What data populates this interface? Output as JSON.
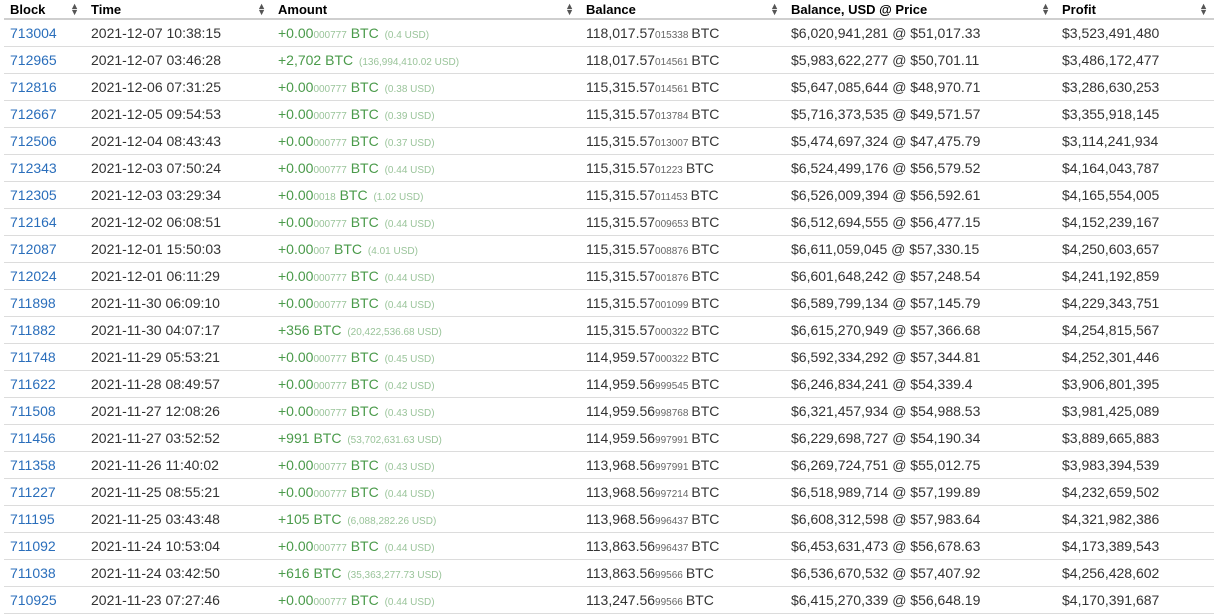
{
  "headers": [
    "Block",
    "Time",
    "Amount",
    "Balance",
    "Balance, USD @ Price",
    "Profit"
  ],
  "rows": [
    {
      "block": "713004",
      "time": "2021-12-07 10:38:15",
      "amount": "+0.00",
      "amount_small": "000777",
      "unit": "BTC",
      "amount_usd": "(0.4 USD)",
      "bal_main": "118,017.57",
      "bal_small": "015338",
      "usd": "$6,020,941,281 @ $51,017.33",
      "profit": "$3,523,491,480"
    },
    {
      "block": "712965",
      "time": "2021-12-07 03:46:28",
      "amount": "+2,702",
      "amount_small": "",
      "unit": "BTC",
      "amount_usd": "(136,994,410.02 USD)",
      "bal_main": "118,017.57",
      "bal_small": "014561",
      "usd": "$5,983,622,277 @ $50,701.11",
      "profit": "$3,486,172,477"
    },
    {
      "block": "712816",
      "time": "2021-12-06 07:31:25",
      "amount": "+0.00",
      "amount_small": "000777",
      "unit": "BTC",
      "amount_usd": "(0.38 USD)",
      "bal_main": "115,315.57",
      "bal_small": "014561",
      "usd": "$5,647,085,644 @ $48,970.71",
      "profit": "$3,286,630,253"
    },
    {
      "block": "712667",
      "time": "2021-12-05 09:54:53",
      "amount": "+0.00",
      "amount_small": "000777",
      "unit": "BTC",
      "amount_usd": "(0.39 USD)",
      "bal_main": "115,315.57",
      "bal_small": "013784",
      "usd": "$5,716,373,535 @ $49,571.57",
      "profit": "$3,355,918,145"
    },
    {
      "block": "712506",
      "time": "2021-12-04 08:43:43",
      "amount": "+0.00",
      "amount_small": "000777",
      "unit": "BTC",
      "amount_usd": "(0.37 USD)",
      "bal_main": "115,315.57",
      "bal_small": "013007",
      "usd": "$5,474,697,324 @ $47,475.79",
      "profit": "$3,114,241,934"
    },
    {
      "block": "712343",
      "time": "2021-12-03 07:50:24",
      "amount": "+0.00",
      "amount_small": "000777",
      "unit": "BTC",
      "amount_usd": "(0.44 USD)",
      "bal_main": "115,315.57",
      "bal_small": "01223",
      "usd": "$6,524,499,176 @ $56,579.52",
      "profit": "$4,164,043,787"
    },
    {
      "block": "712305",
      "time": "2021-12-03 03:29:34",
      "amount": "+0.00",
      "amount_small": "0018",
      "unit": "BTC",
      "amount_usd": "(1.02 USD)",
      "bal_main": "115,315.57",
      "bal_small": "011453",
      "usd": "$6,526,009,394 @ $56,592.61",
      "profit": "$4,165,554,005"
    },
    {
      "block": "712164",
      "time": "2021-12-02 06:08:51",
      "amount": "+0.00",
      "amount_small": "000777",
      "unit": "BTC",
      "amount_usd": "(0.44 USD)",
      "bal_main": "115,315.57",
      "bal_small": "009653",
      "usd": "$6,512,694,555 @ $56,477.15",
      "profit": "$4,152,239,167"
    },
    {
      "block": "712087",
      "time": "2021-12-01 15:50:03",
      "amount": "+0.00",
      "amount_small": "007",
      "unit": "BTC",
      "amount_usd": "(4.01 USD)",
      "bal_main": "115,315.57",
      "bal_small": "008876",
      "usd": "$6,611,059,045 @ $57,330.15",
      "profit": "$4,250,603,657"
    },
    {
      "block": "712024",
      "time": "2021-12-01 06:11:29",
      "amount": "+0.00",
      "amount_small": "000777",
      "unit": "BTC",
      "amount_usd": "(0.44 USD)",
      "bal_main": "115,315.57",
      "bal_small": "001876",
      "usd": "$6,601,648,242 @ $57,248.54",
      "profit": "$4,241,192,859"
    },
    {
      "block": "711898",
      "time": "2021-11-30 06:09:10",
      "amount": "+0.00",
      "amount_small": "000777",
      "unit": "BTC",
      "amount_usd": "(0.44 USD)",
      "bal_main": "115,315.57",
      "bal_small": "001099",
      "usd": "$6,589,799,134 @ $57,145.79",
      "profit": "$4,229,343,751"
    },
    {
      "block": "711882",
      "time": "2021-11-30 04:07:17",
      "amount": "+356",
      "amount_small": "",
      "unit": "BTC",
      "amount_usd": "(20,422,536.68 USD)",
      "bal_main": "115,315.57",
      "bal_small": "000322",
      "usd": "$6,615,270,949 @ $57,366.68",
      "profit": "$4,254,815,567"
    },
    {
      "block": "711748",
      "time": "2021-11-29 05:53:21",
      "amount": "+0.00",
      "amount_small": "000777",
      "unit": "BTC",
      "amount_usd": "(0.45 USD)",
      "bal_main": "114,959.57",
      "bal_small": "000322",
      "usd": "$6,592,334,292 @ $57,344.81",
      "profit": "$4,252,301,446"
    },
    {
      "block": "711622",
      "time": "2021-11-28 08:49:57",
      "amount": "+0.00",
      "amount_small": "000777",
      "unit": "BTC",
      "amount_usd": "(0.42 USD)",
      "bal_main": "114,959.56",
      "bal_small": "999545",
      "usd": "$6,246,834,241 @ $54,339.4",
      "profit": "$3,906,801,395"
    },
    {
      "block": "711508",
      "time": "2021-11-27 12:08:26",
      "amount": "+0.00",
      "amount_small": "000777",
      "unit": "BTC",
      "amount_usd": "(0.43 USD)",
      "bal_main": "114,959.56",
      "bal_small": "998768",
      "usd": "$6,321,457,934 @ $54,988.53",
      "profit": "$3,981,425,089"
    },
    {
      "block": "711456",
      "time": "2021-11-27 03:52:52",
      "amount": "+991",
      "amount_small": "",
      "unit": "BTC",
      "amount_usd": "(53,702,631.63 USD)",
      "bal_main": "114,959.56",
      "bal_small": "997991",
      "usd": "$6,229,698,727 @ $54,190.34",
      "profit": "$3,889,665,883"
    },
    {
      "block": "711358",
      "time": "2021-11-26 11:40:02",
      "amount": "+0.00",
      "amount_small": "000777",
      "unit": "BTC",
      "amount_usd": "(0.43 USD)",
      "bal_main": "113,968.56",
      "bal_small": "997991",
      "usd": "$6,269,724,751 @ $55,012.75",
      "profit": "$3,983,394,539"
    },
    {
      "block": "711227",
      "time": "2021-11-25 08:55:21",
      "amount": "+0.00",
      "amount_small": "000777",
      "unit": "BTC",
      "amount_usd": "(0.44 USD)",
      "bal_main": "113,968.56",
      "bal_small": "997214",
      "usd": "$6,518,989,714 @ $57,199.89",
      "profit": "$4,232,659,502"
    },
    {
      "block": "711195",
      "time": "2021-11-25 03:43:48",
      "amount": "+105",
      "amount_small": "",
      "unit": "BTC",
      "amount_usd": "(6,088,282.26 USD)",
      "bal_main": "113,968.56",
      "bal_small": "996437",
      "usd": "$6,608,312,598 @ $57,983.64",
      "profit": "$4,321,982,386"
    },
    {
      "block": "711092",
      "time": "2021-11-24 10:53:04",
      "amount": "+0.00",
      "amount_small": "000777",
      "unit": "BTC",
      "amount_usd": "(0.44 USD)",
      "bal_main": "113,863.56",
      "bal_small": "996437",
      "usd": "$6,453,631,473 @ $56,678.63",
      "profit": "$4,173,389,543"
    },
    {
      "block": "711038",
      "time": "2021-11-24 03:42:50",
      "amount": "+616",
      "amount_small": "",
      "unit": "BTC",
      "amount_usd": "(35,363,277.73 USD)",
      "bal_main": "113,863.56",
      "bal_small": "99566",
      "usd": "$6,536,670,532 @ $57,407.92",
      "profit": "$4,256,428,602"
    },
    {
      "block": "710925",
      "time": "2021-11-23 07:27:46",
      "amount": "+0.00",
      "amount_small": "000777",
      "unit": "BTC",
      "amount_usd": "(0.44 USD)",
      "bal_main": "113,247.56",
      "bal_small": "99566",
      "usd": "$6,415,270,339 @ $56,648.19",
      "profit": "$4,170,391,687"
    }
  ]
}
